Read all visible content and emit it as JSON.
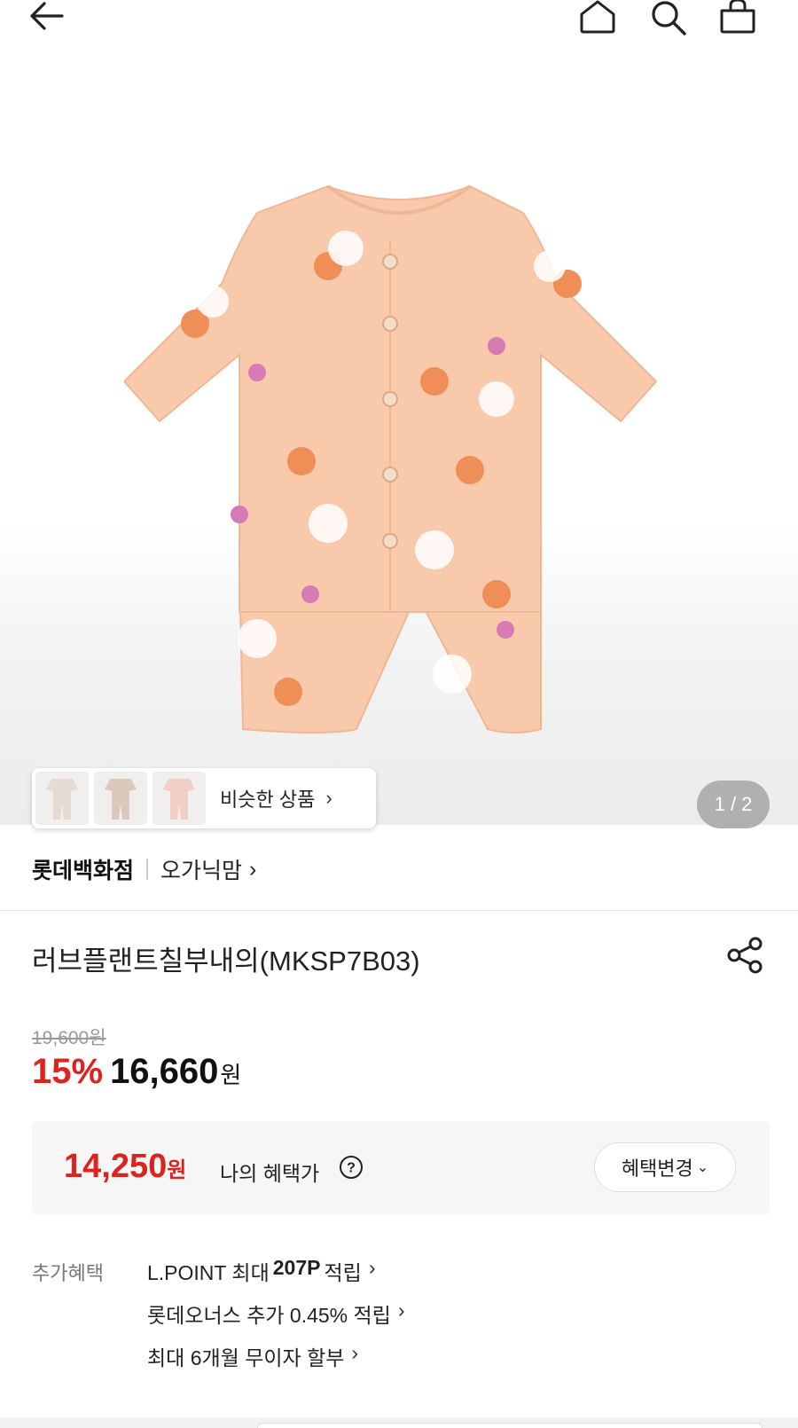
{
  "header": {
    "back_icon": "arrow-left-icon",
    "home_icon": "home-icon",
    "search_icon": "search-icon",
    "cart_icon": "shopping-bag-icon"
  },
  "gallery": {
    "similar_label": "비슷한 상품",
    "similar_chevron": "›",
    "page_indicator": "1 / 2",
    "product_color": "#f8c9ab"
  },
  "brand": {
    "main": "롯데백화점",
    "sub": "오가닉맘",
    "chevron": "›"
  },
  "product": {
    "title": "러브플랜트칠부내의(MKSP7B03)",
    "share_icon": "share-icon"
  },
  "price": {
    "original": "19,600원",
    "discount": "15%",
    "sale": "16,660",
    "unit": "원"
  },
  "benefit": {
    "price": "14,250",
    "unit": "원",
    "label": "나의 혜택가",
    "help_icon": "question-circle-icon",
    "change_label": "혜택변경",
    "change_chevron": "⌄"
  },
  "extra": {
    "label": "추가혜택",
    "items": [
      {
        "prefix": "L.POINT 최대",
        "bold": "207P",
        "suffix": "적립"
      },
      {
        "text": "롯데오너스 추가 0.45% 적립"
      },
      {
        "text": "최대 6개월 무이자 할부"
      }
    ]
  },
  "colors": {
    "accent_red": "#e0221e"
  }
}
